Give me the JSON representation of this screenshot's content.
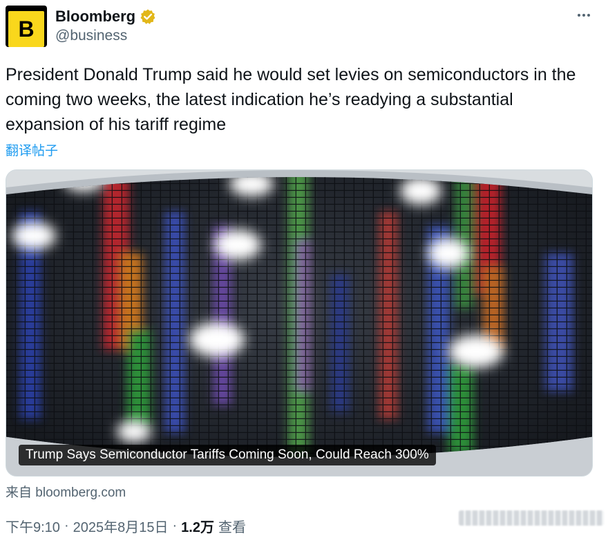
{
  "account": {
    "avatar_letter": "B",
    "display_name": "Bloomberg",
    "handle": "@business",
    "verified_badge_color": "#e2b719"
  },
  "tweet": {
    "text": "President Donald Trump said he would set levies on semiconductors in the coming two weeks, the latest indication he’s readying a substantial expansion of his tariff regime",
    "translate_label": "翻译帖子"
  },
  "card": {
    "image_icon": "semiconductor-wafer-photo",
    "caption": "Trump Says Semiconductor Tariffs Coming Soon, Could Reach 300%",
    "source": "来自 bloomberg.com"
  },
  "meta": {
    "time": "下午9:10",
    "date": "2025年8月15日",
    "views_count": "1.2万",
    "views_label": "查看",
    "separator": "·"
  },
  "colors": {
    "link": "#1d9bf0",
    "secondary_text": "#536471",
    "primary_text": "#0f1419",
    "brand_yellow": "#f9d71c"
  }
}
